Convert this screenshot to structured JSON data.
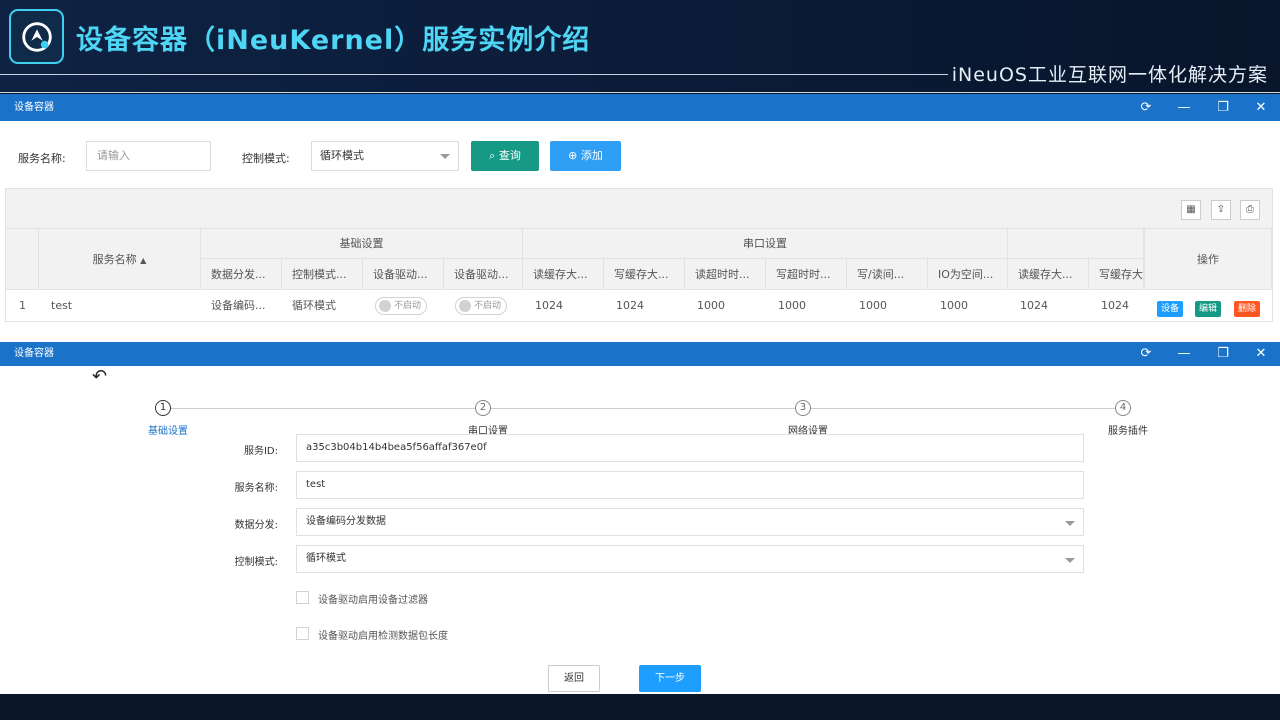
{
  "header": {
    "title": "设备容器（iNeuKernel）服务实例介绍",
    "tagline": "iNeuOS工业互联网一体化解决方案"
  },
  "window1": {
    "title": "设备容器",
    "controls": {
      "refresh": "⟳",
      "minimize": "—",
      "restore": "❐",
      "close": "✕"
    },
    "search": {
      "service_name_label": "服务名称:",
      "service_name_placeholder": "请输入",
      "control_mode_label": "控制模式:",
      "control_mode_value": "循环模式",
      "query_label": "查询",
      "add_label": "添加"
    },
    "table": {
      "group_headers": [
        "基础设置",
        "串口设置"
      ],
      "service_name_header": "服务名称",
      "action_header": "操作",
      "columns": [
        "数据分发...",
        "控制模式...",
        "设备驱动...",
        "设备驱动...",
        "读缓存大...",
        "写缓存大...",
        "读超时时...",
        "写超时时...",
        "写/读间...",
        "IO为空间...",
        "读缓存大...",
        "写缓存大"
      ],
      "row": {
        "index": "1",
        "name": "test",
        "cells": [
          "设备编码...",
          "循环模式",
          "不启动",
          "不启动",
          "1024",
          "1024",
          "1000",
          "1000",
          "1000",
          "1000",
          "1024",
          "1024"
        ],
        "actions": [
          "设备",
          "编辑",
          "删除"
        ]
      }
    }
  },
  "window2": {
    "title": "设备容器",
    "steps": [
      {
        "num": "1",
        "label": "基础设置"
      },
      {
        "num": "2",
        "label": "串口设置"
      },
      {
        "num": "3",
        "label": "网络设置"
      },
      {
        "num": "4",
        "label": "服务插件"
      }
    ],
    "form": {
      "service_id_label": "服务ID:",
      "service_id_value": "a35c3b04b14b4bea5f56affaf367e0f",
      "service_name_label": "服务名称:",
      "service_name_value": "test",
      "data_dispatch_label": "数据分发:",
      "data_dispatch_value": "设备编码分发数据",
      "control_mode_label": "控制模式:",
      "control_mode_value": "循环模式",
      "checkbox1": "设备驱动启用设备过滤器",
      "checkbox2": "设备驱动启用检测数据包长度",
      "back_label": "返回",
      "next_label": "下一步"
    }
  },
  "colors": {
    "titlebar": "#1a73c9",
    "query_button": "#169a86",
    "add_button": "#2f9ef5",
    "device_button": "#1e9fff",
    "edit_button": "#169a86",
    "delete_button": "#ff5722",
    "title_text": "#4fd6f5"
  },
  "icons": [
    "brand-logo-icon",
    "refresh-icon",
    "minimize-icon",
    "restore-icon",
    "close-icon",
    "search-icon",
    "plus-circle-icon",
    "columns-icon",
    "export-icon",
    "print-icon",
    "sort-icon",
    "back-arrow-icon"
  ]
}
